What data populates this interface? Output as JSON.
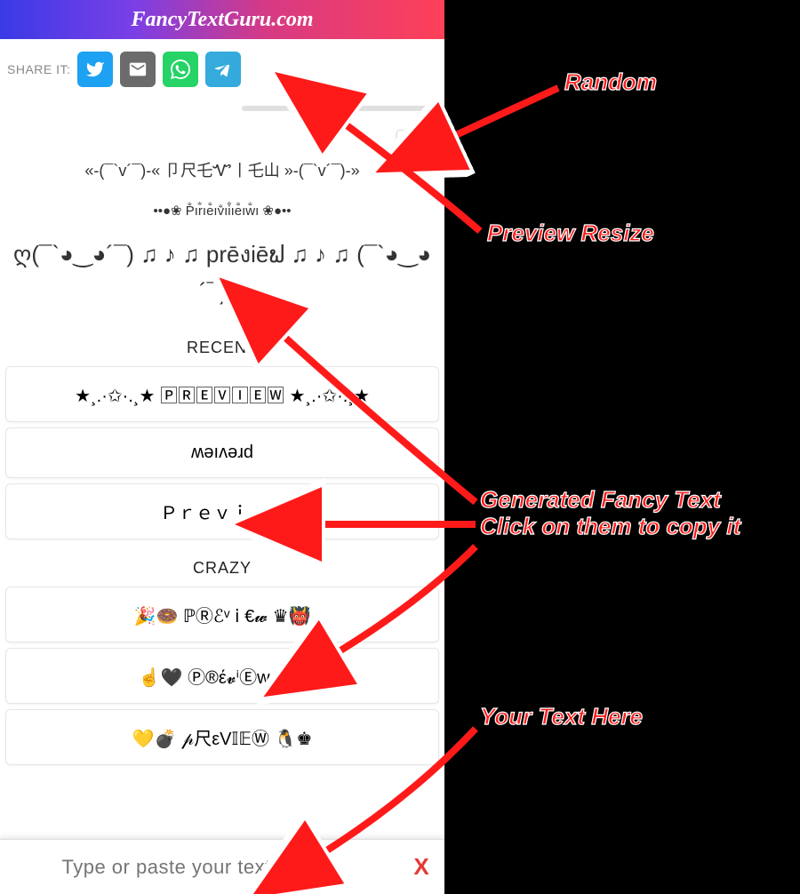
{
  "header": {
    "title": "FancyTextGuru.com"
  },
  "share": {
    "label": "SHARE IT:",
    "twitter_icon": "twitter-icon",
    "email_icon": "email-icon",
    "whatsapp_icon": "whatsapp-icon",
    "telegram_icon": "telegram-icon"
  },
  "slider": {
    "value": 35,
    "min": 0,
    "max": 100
  },
  "random": {
    "icon": "shuffle-icon"
  },
  "preview": {
    "line1": "«-(¯`v´¯)-« 卩尺乇Ꮙ丨乇山 »-(¯`v´¯)-»",
    "line2": "••●❀ P̐ır̐ıe̐ıv̐ıi̐ıe̐ıw̐ı ❀●••",
    "line3": "ღ(¯`◕‿◕´¯) ♫ ♪ ♫ prēงiēຟ ♫ ♪ ♫ (¯`◕‿◕´¯)ღ"
  },
  "sections": {
    "recent": {
      "title": "RECENT",
      "items": [
        "★¸.·✩·.¸★ 🄿🅁🄴🅅🄸🄴🅆 ★¸.·✩·.¸★",
        "ʍǝıʌǝɹd",
        "Ｐｒｅｖｉｅｗ"
      ]
    },
    "crazy": {
      "title": "CRAZY",
      "items": [
        "🎉🍩 ℙⓇℰᵛ 𝗂 €𝔀  ♛👹",
        "☝🖤  Ⓟ®έ𝓿ⁱⒺw  ♦🎀",
        "💛💣  𝓅尺εV𝕀𝔼Ⓦ  🐧♚"
      ]
    }
  },
  "input": {
    "placeholder": "Type or paste your text here :)",
    "value": "",
    "clear_label": "X"
  },
  "annotations": {
    "random": "Random",
    "resize": "Preview Resize",
    "generated": "Generated Fancy Text Click on them to copy it",
    "yourtext": "Your Text Here"
  },
  "colors": {
    "annotation_red": "#ff1a1a",
    "gradient_start": "#3a3ae6",
    "gradient_end": "#ff4058"
  }
}
